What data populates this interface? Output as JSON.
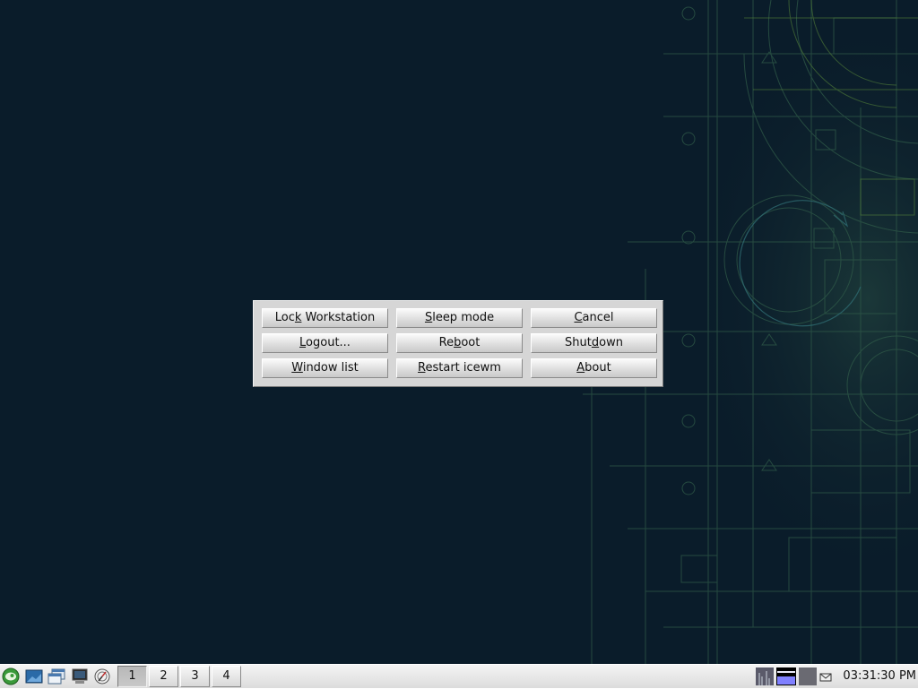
{
  "desktop": {
    "background_color": "#0a1c2a",
    "wallpaper_accent": "#3f7a4f"
  },
  "dialog": {
    "buttons": [
      {
        "label": "Lock Workstation",
        "mnemonic": "k"
      },
      {
        "label": "Sleep mode",
        "mnemonic": "S"
      },
      {
        "label": "Cancel",
        "mnemonic": "C"
      },
      {
        "label": "Logout...",
        "mnemonic": "L"
      },
      {
        "label": "Reboot",
        "mnemonic": "b"
      },
      {
        "label": "Shutdown",
        "mnemonic": "d"
      },
      {
        "label": "Window list",
        "mnemonic": "W"
      },
      {
        "label": "Restart icewm",
        "mnemonic": "R"
      },
      {
        "label": "About",
        "mnemonic": "A"
      }
    ]
  },
  "taskbar": {
    "launchers": [
      {
        "icon": "start-menu-icon"
      },
      {
        "icon": "show-desktop-icon"
      },
      {
        "icon": "window-list-icon"
      },
      {
        "icon": "terminal-icon"
      },
      {
        "icon": "web-browser-icon"
      }
    ],
    "workspaces": [
      {
        "label": "1",
        "active": true
      },
      {
        "label": "2",
        "active": false
      },
      {
        "label": "3",
        "active": false
      },
      {
        "label": "4",
        "active": false
      }
    ],
    "tray": {
      "cpu_monitor": "cpu-monitor-icon",
      "net_monitor": "network-monitor-icon",
      "mem_monitor": "memory-monitor-icon",
      "mail": "mail-icon"
    },
    "clock": "03:31:30 PM"
  }
}
